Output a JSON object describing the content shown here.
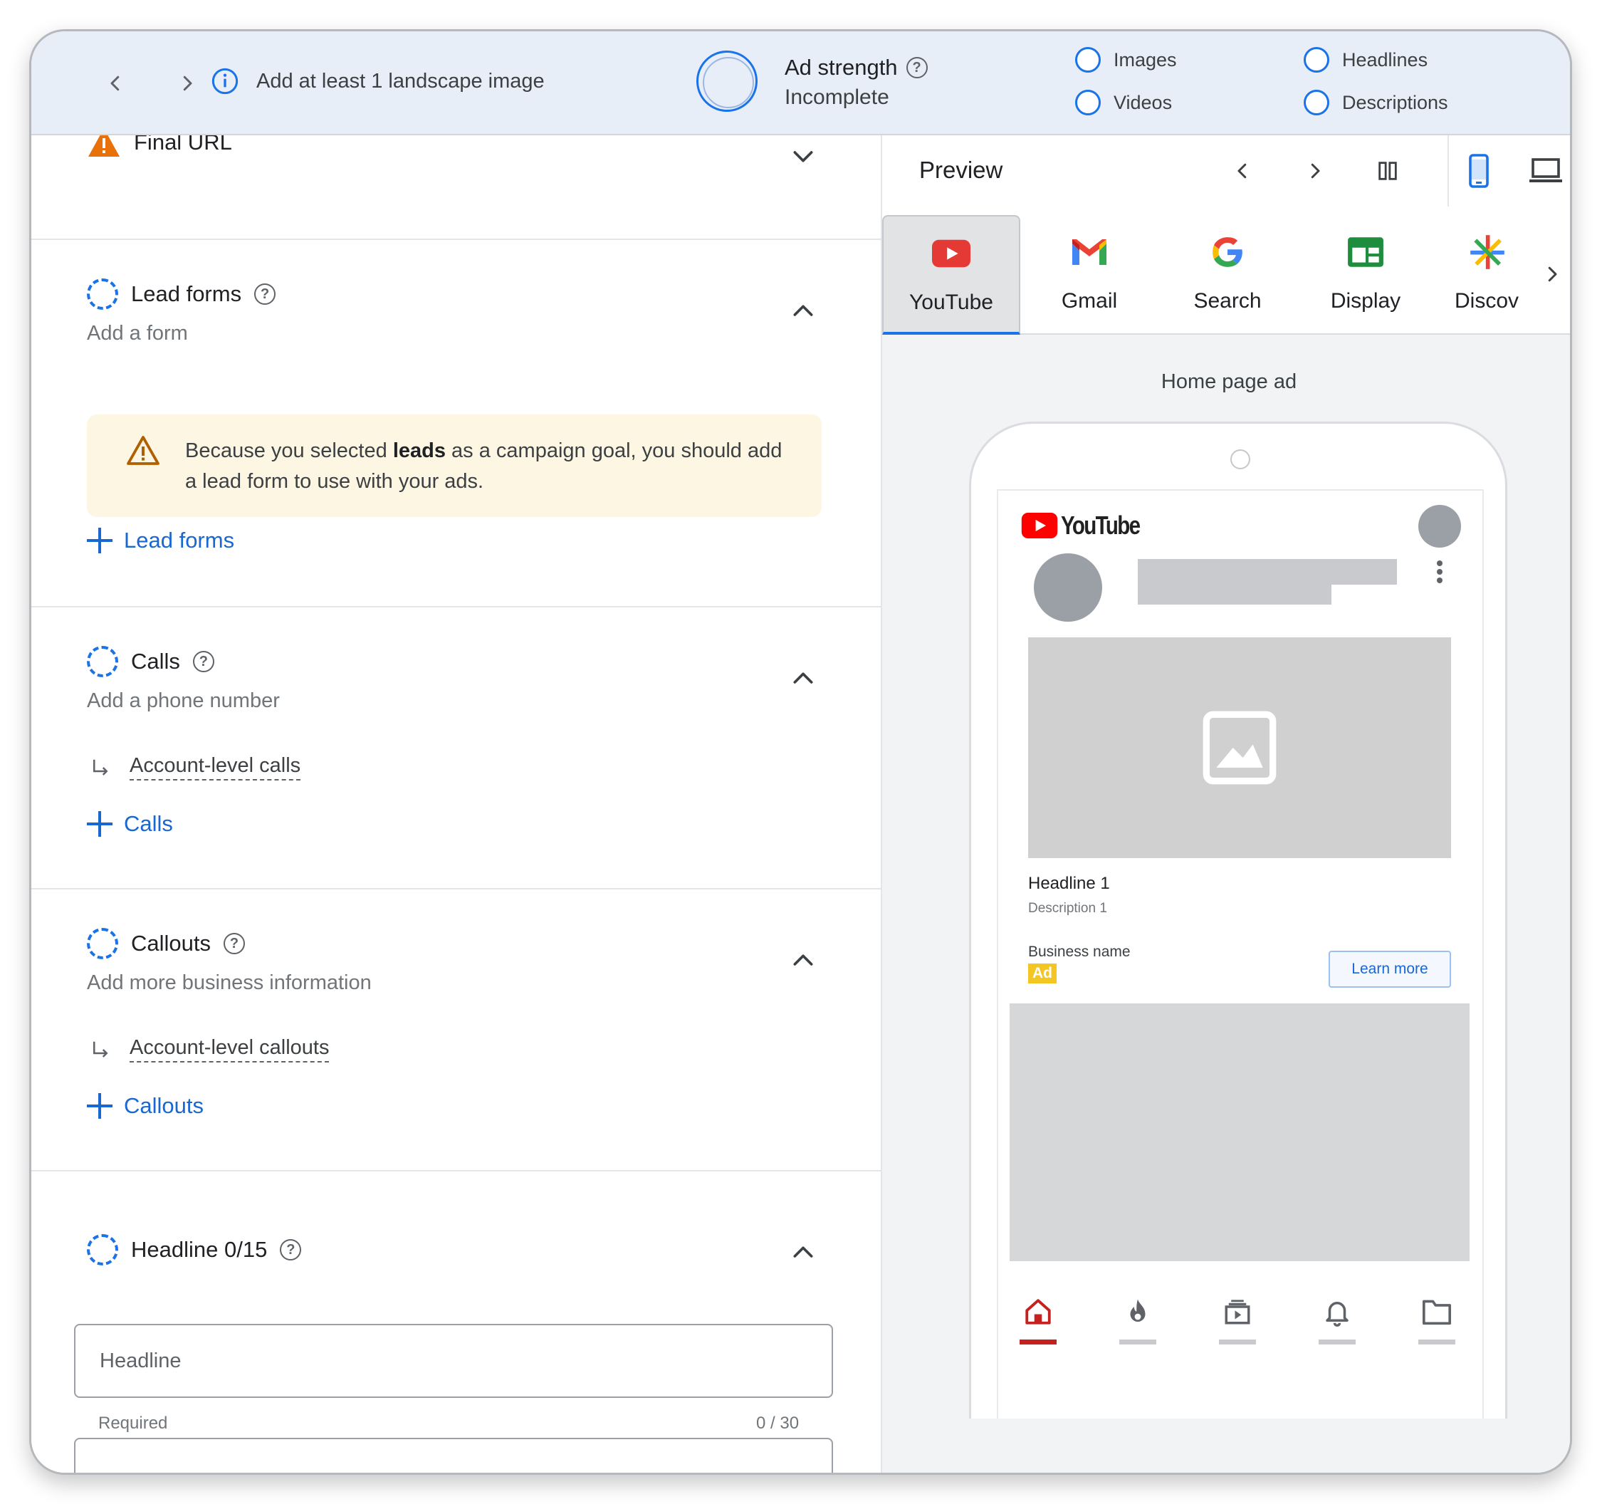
{
  "topbar": {
    "tip": "Add at least 1 landscape image",
    "ad_strength_title": "Ad strength",
    "ad_strength_value": "Incomplete",
    "checklist": [
      "Images",
      "Videos",
      "Headlines",
      "Descriptions"
    ]
  },
  "left": {
    "final_url": "Final URL",
    "lead_forms": {
      "title": "Lead forms",
      "subtitle": "Add a form",
      "warning_pre": "Because you selected ",
      "warning_bold": "leads",
      "warning_post": " as a campaign goal, you should add a lead form to use with your ads.",
      "add_label": "Lead forms"
    },
    "calls": {
      "title": "Calls",
      "subtitle": "Add a phone number",
      "account_link": "Account-level calls",
      "add_label": "Calls"
    },
    "callouts": {
      "title": "Callouts",
      "subtitle": "Add more business information",
      "account_link": "Account-level callouts",
      "add_label": "Callouts"
    },
    "headline": {
      "title": "Headline 0/15",
      "placeholder": "Headline",
      "helper": "Required",
      "counter": "0 / 30"
    }
  },
  "preview": {
    "title": "Preview",
    "tabs": [
      "YouTube",
      "Gmail",
      "Search",
      "Display",
      "Discov"
    ],
    "active_tab": "YouTube",
    "ad_type": "Home page ad",
    "youtube_word": "YouTube",
    "ad": {
      "headline": "Headline 1",
      "description": "Description 1",
      "business": "Business name",
      "badge": "Ad",
      "cta": "Learn more"
    }
  },
  "colors": {
    "accent": "#1a73e8",
    "link": "#1a67d2",
    "warning_bg": "#fdf6e3",
    "warning_icon": "#b06000",
    "topbar_bg": "#e8eef8",
    "youtube_red": "#ff0000"
  }
}
